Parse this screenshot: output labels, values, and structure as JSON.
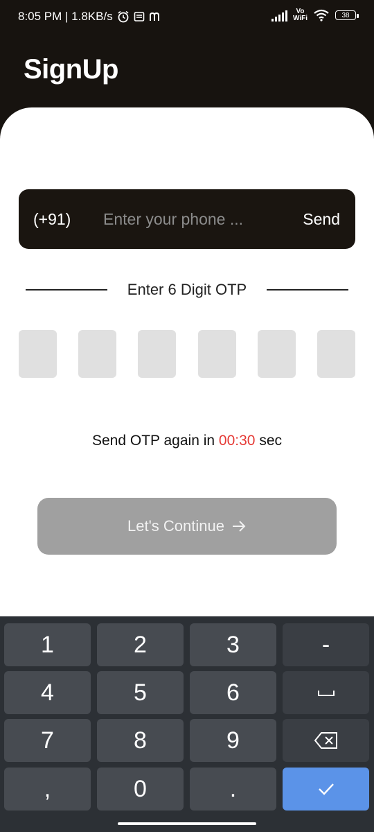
{
  "status_bar": {
    "time_speed": "8:05 PM | 1.8KB/s",
    "icons": [
      "alarm-icon",
      "notification-icon",
      "m-icon",
      "signal-icon",
      "vowifi-icon",
      "wifi-icon",
      "battery-icon"
    ],
    "vowifi_top": "Vo",
    "vowifi_bottom": "WiFi",
    "battery_level": "38"
  },
  "header": {
    "title": "SignUp"
  },
  "phone": {
    "country_code": "(+91)",
    "placeholder": "Enter your phone ...",
    "send_label": "Send"
  },
  "otp": {
    "label": "Enter 6 Digit OTP",
    "digits": [
      "",
      "",
      "",
      "",
      "",
      ""
    ]
  },
  "resend": {
    "prefix": "Send OTP again in",
    "timer": "00:30",
    "suffix": "sec"
  },
  "continue_button": {
    "label": "Let's Continue",
    "icon": "arrow-right-icon"
  },
  "keyboard": {
    "keys": [
      "1",
      "2",
      "3",
      "-",
      "4",
      "5",
      "6",
      "space-icon",
      "7",
      "8",
      "9",
      "backspace-icon",
      ",",
      "0",
      ".",
      "check-icon"
    ]
  },
  "colors": {
    "header_bg": "#17130f",
    "timer": "#e53935",
    "continue_disabled": "#a0a0a0",
    "done_key": "#5b93e8"
  }
}
